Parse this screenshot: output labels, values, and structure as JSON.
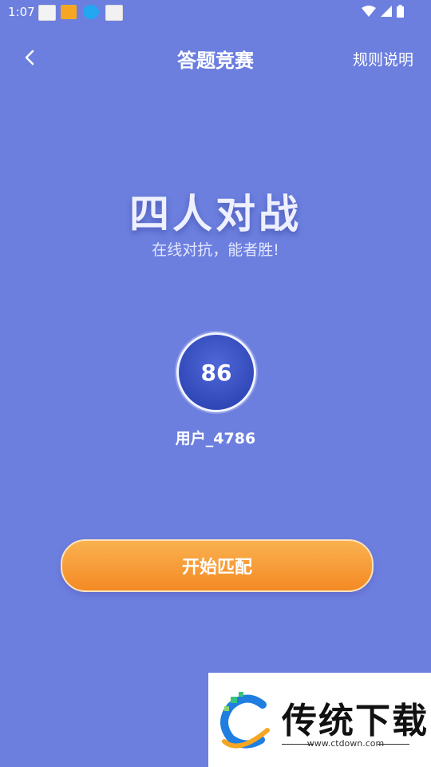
{
  "status": {
    "time": "1:07"
  },
  "topbar": {
    "title": "答题竞赛",
    "rules": "规则说明"
  },
  "hero": {
    "title": "四人对战",
    "subtitle": "在线对抗，能者胜!"
  },
  "user": {
    "score": "86",
    "name": "用户_4786"
  },
  "start_button": "开始匹配",
  "watermark": {
    "brand": "传统下载",
    "url": "www.ctdown.com"
  },
  "colors": {
    "background": "#6c7fdf",
    "button": "#f48a25",
    "avatar": "#2f47b6"
  }
}
